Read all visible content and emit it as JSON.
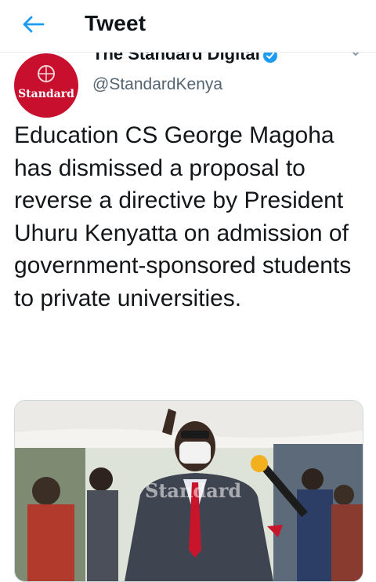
{
  "header": {
    "title": "Tweet",
    "back_icon": "arrow-left-icon"
  },
  "tweet": {
    "author": {
      "display_name": "The Standard Digital",
      "handle": "@StandardKenya",
      "verified": true,
      "avatar_text": "Standard"
    },
    "text": "Education CS George Magoha has dismissed a proposal to reverse a directive by President Uhuru Kenyatta on admission of government-sponsored students to private universities.",
    "media": {
      "watermark": "Standard"
    }
  },
  "colors": {
    "accent": "#1d9bf0",
    "brand_red": "#c8102e"
  }
}
